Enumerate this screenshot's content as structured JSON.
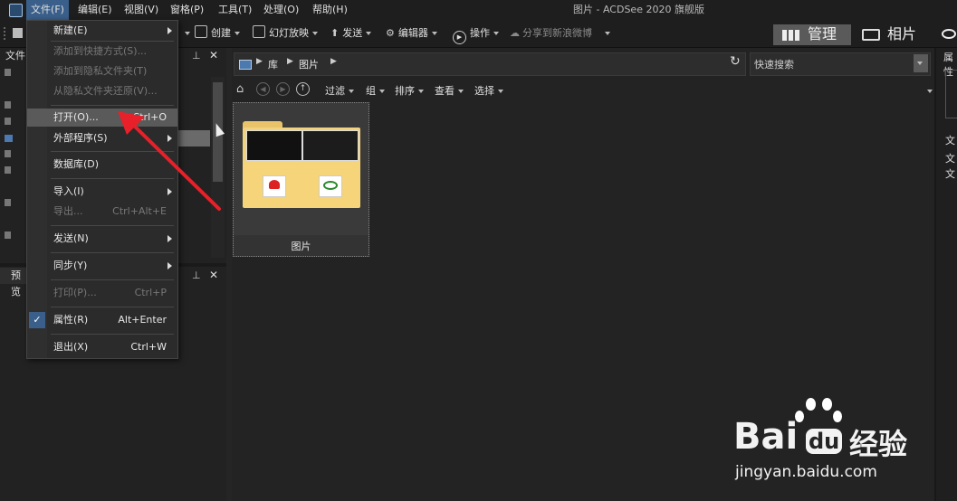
{
  "window_title": "图片 - ACDSee 2020 旗舰版",
  "menubar": [
    "文件(F)",
    "编辑(E)",
    "视图(V)",
    "窗格(P)",
    "工具(T)",
    "处理(O)",
    "帮助(H)"
  ],
  "toolbar": {
    "create": "创建",
    "slideshow": "幻灯放映",
    "send": "发送",
    "editor": "编辑器",
    "actions": "操作",
    "share": "分享到新浪微博"
  },
  "modes": {
    "manage": "管理",
    "photos": "相片"
  },
  "left_panel": {
    "folders_title": "文件",
    "preview_title": "预览"
  },
  "address": {
    "root": "库",
    "current": "图片"
  },
  "search": {
    "placeholder": "快速搜索"
  },
  "filter_bar": [
    "过滤",
    "组",
    "排序",
    "查看",
    "选择"
  ],
  "thumbnail": {
    "label": "图片"
  },
  "file_menu": [
    {
      "label": "新建(E)",
      "shortcut": "",
      "submenu": true,
      "enabled": true
    },
    {
      "label": "添加到快捷方式(S)...",
      "shortcut": "",
      "submenu": false,
      "enabled": false
    },
    {
      "label": "添加到隐私文件夹(T)",
      "shortcut": "",
      "submenu": false,
      "enabled": false
    },
    {
      "label": "从隐私文件夹还原(V)...",
      "shortcut": "",
      "submenu": false,
      "enabled": false
    },
    {
      "label": "打开(O)...",
      "shortcut": "Ctrl+O",
      "submenu": false,
      "enabled": true,
      "highlighted": true
    },
    {
      "label": "外部程序(S)",
      "shortcut": "",
      "submenu": true,
      "enabled": true
    },
    {
      "label": "数据库(D)",
      "shortcut": "",
      "submenu": false,
      "enabled": true
    },
    {
      "label": "导入(I)",
      "shortcut": "",
      "submenu": true,
      "enabled": true
    },
    {
      "label": "导出...",
      "shortcut": "Ctrl+Alt+E",
      "submenu": false,
      "enabled": false
    },
    {
      "label": "发送(N)",
      "shortcut": "",
      "submenu": true,
      "enabled": true
    },
    {
      "label": "同步(Y)",
      "shortcut": "",
      "submenu": true,
      "enabled": true
    },
    {
      "label": "打印(P)...",
      "shortcut": "Ctrl+P",
      "submenu": false,
      "enabled": false
    },
    {
      "label": "属性(R)",
      "shortcut": "Alt+Enter",
      "submenu": false,
      "enabled": true,
      "checked": true
    },
    {
      "label": "退出(X)",
      "shortcut": "Ctrl+W",
      "submenu": false,
      "enabled": true
    }
  ],
  "right_panel": {
    "title": "属性",
    "labels": [
      "文",
      "文",
      "文"
    ]
  },
  "watermark": {
    "brand": "Bai",
    "brand2": "du",
    "cn": "经验",
    "url": "jingyan.baidu.com"
  }
}
